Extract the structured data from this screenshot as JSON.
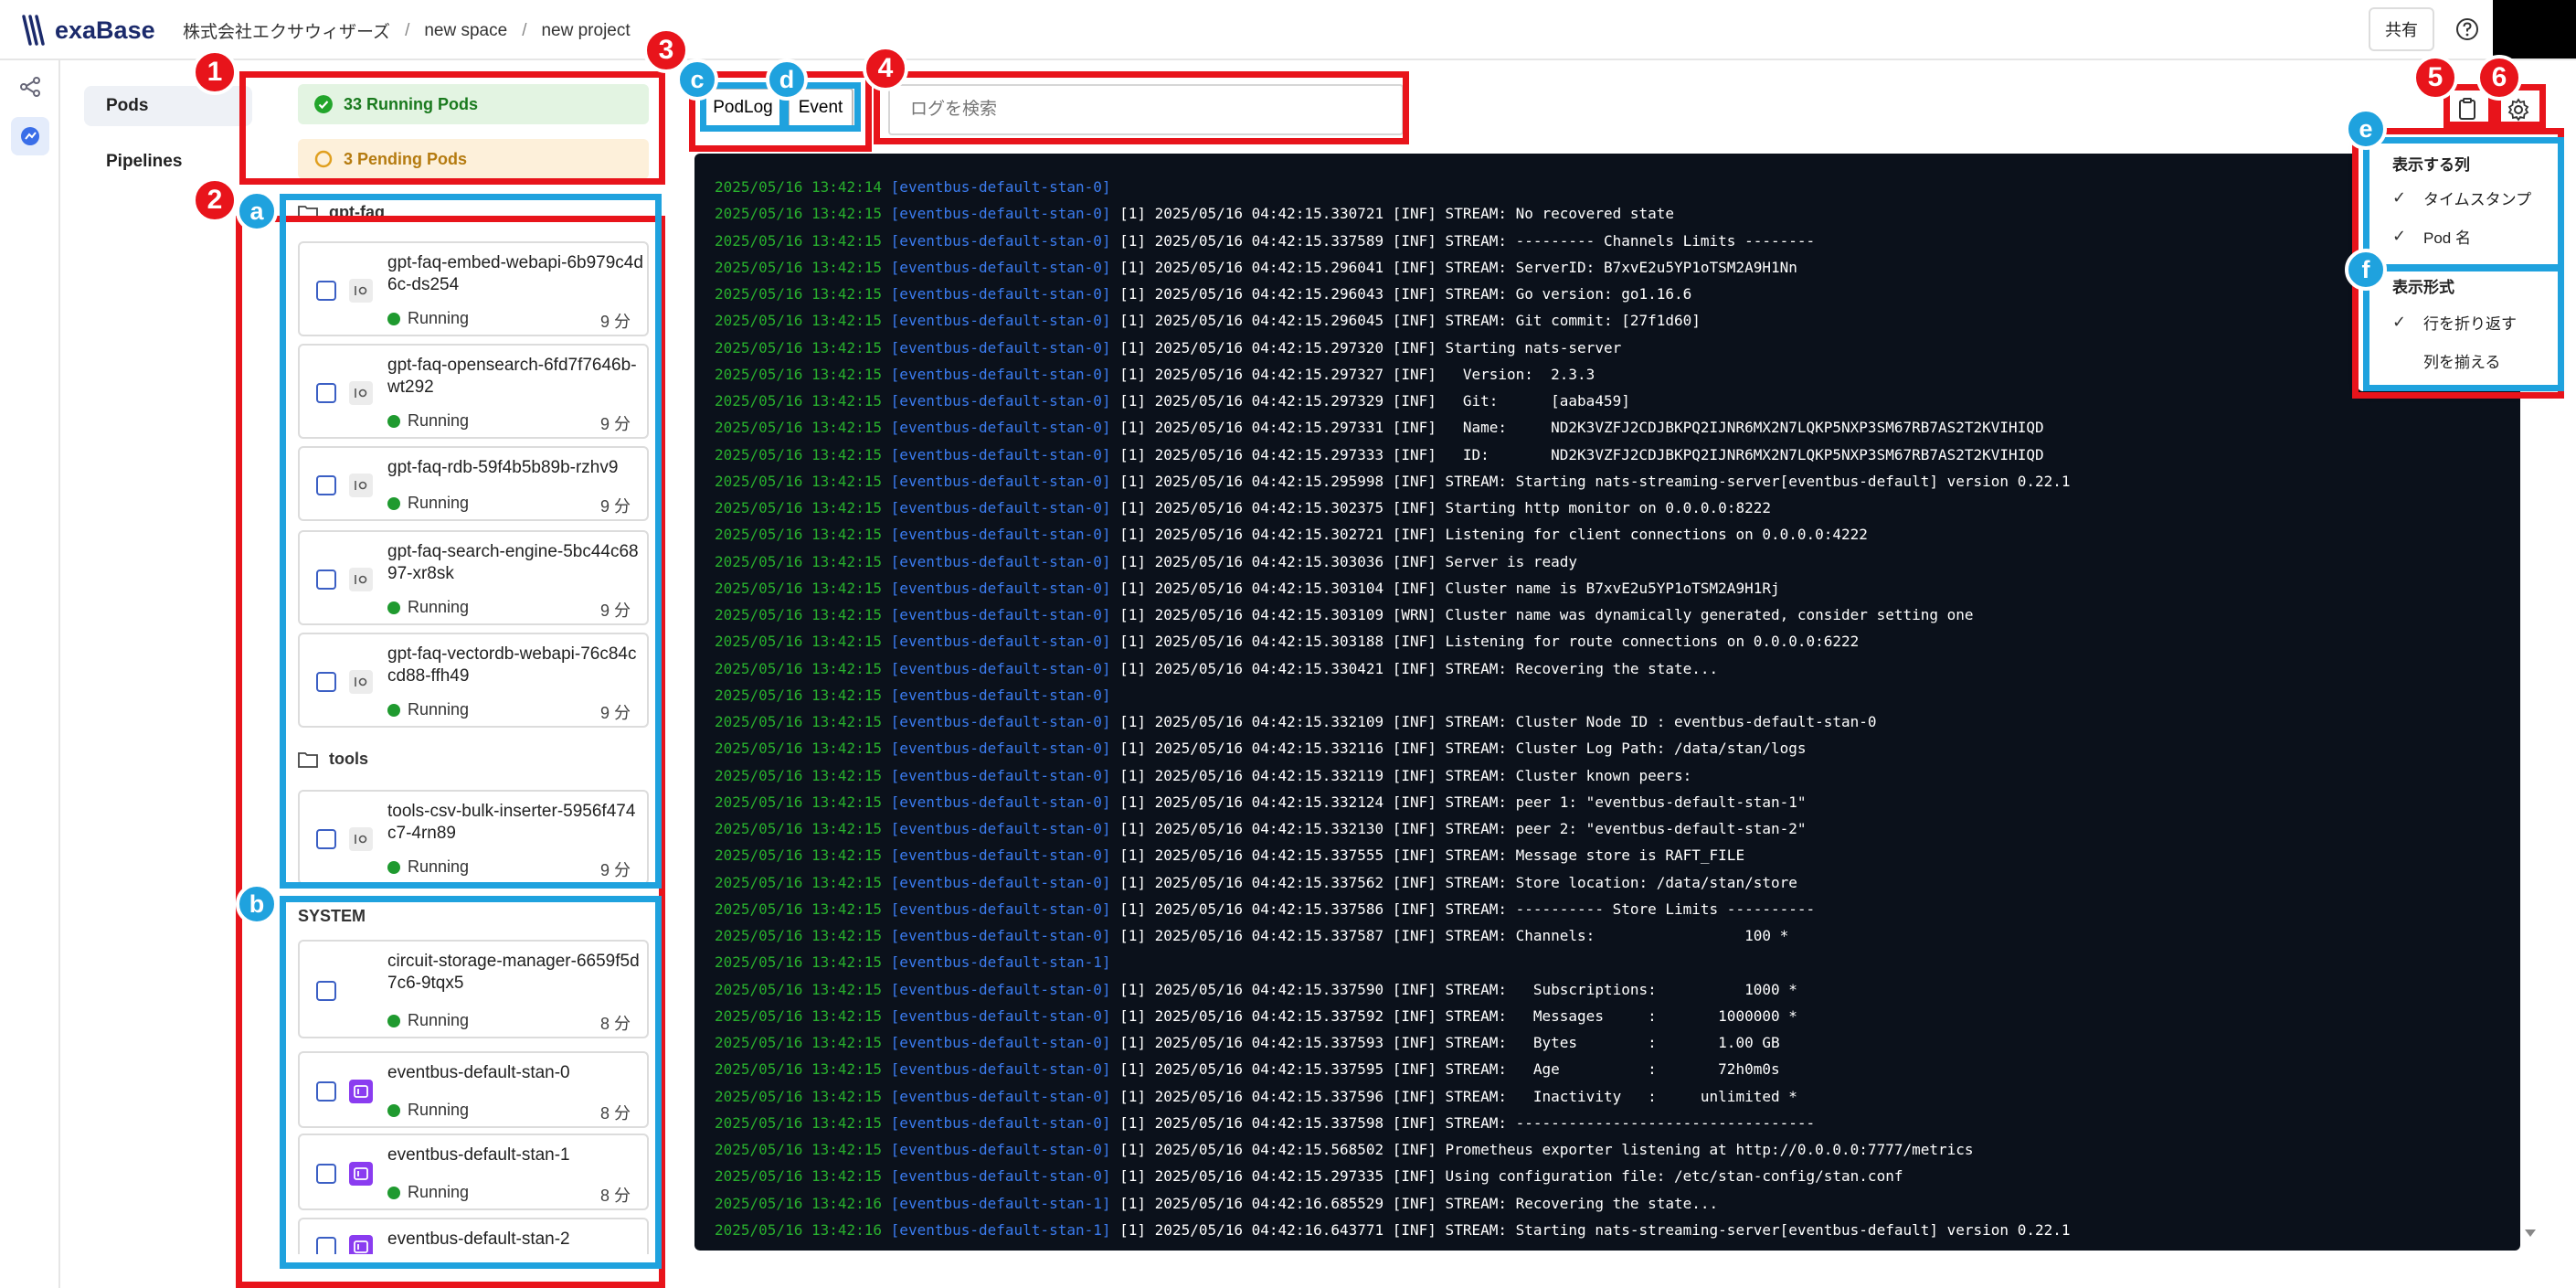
{
  "app": {
    "logo": "exaBase",
    "breadcrumb": [
      "株式会社エクサウィザーズ",
      "new space",
      "new project"
    ],
    "share_label": "共有"
  },
  "nav": {
    "pods": "Pods",
    "pipelines": "Pipelines"
  },
  "stats": {
    "running": "33 Running Pods",
    "pending": "3 Pending Pods"
  },
  "groups": {
    "gptfaq": "gpt-faq",
    "tools": "tools",
    "system": "SYSTEM"
  },
  "pods": [
    {
      "name": "gpt-faq-embed-webapi-6b979c4d6c-ds254",
      "status": "Running",
      "age": "9 分"
    },
    {
      "name": "gpt-faq-opensearch-6fd7f7646b-wt292",
      "status": "Running",
      "age": "9 分"
    },
    {
      "name": "gpt-faq-rdb-59f4b5b89b-rzhv9",
      "status": "Running",
      "age": "9 分"
    },
    {
      "name": "gpt-faq-search-engine-5bc44c6897-xr8sk",
      "status": "Running",
      "age": "9 分"
    },
    {
      "name": "gpt-faq-vectordb-webapi-76c84ccd88-ffh49",
      "status": "Running",
      "age": "9 分"
    },
    {
      "name": "tools-csv-bulk-inserter-5956f474c7-4rn89",
      "status": "Running",
      "age": "9 分"
    },
    {
      "name": "circuit-storage-manager-6659f5d7c6-9tqx5",
      "status": "Running",
      "age": "8 分"
    },
    {
      "name": "eventbus-default-stan-0",
      "status": "Running",
      "age": "8 分"
    },
    {
      "name": "eventbus-default-stan-1",
      "status": "Running",
      "age": "8 分"
    },
    {
      "name": "eventbus-default-stan-2",
      "status": "",
      "age": ""
    }
  ],
  "tabs": {
    "podlog": "PodLog",
    "event": "Event"
  },
  "search": {
    "placeholder": "ログを検索"
  },
  "menu": {
    "columns_h": "表示する列",
    "timestamp": "タイムスタンプ",
    "podname": "Pod 名",
    "format_h": "表示形式",
    "wrap": "行を折り返す",
    "align": "列を揃える"
  },
  "annotations": [
    "1",
    "2",
    "3",
    "4",
    "5",
    "6",
    "a",
    "b",
    "c",
    "d",
    "e",
    "f"
  ],
  "logs": [
    [
      "2025/05/16 13:42:14",
      "[eventbus-default-stan-0]",
      ""
    ],
    [
      "2025/05/16 13:42:15",
      "[eventbus-default-stan-0]",
      "[1] 2025/05/16 04:42:15.330721 [INF] STREAM: No recovered state"
    ],
    [
      "2025/05/16 13:42:15",
      "[eventbus-default-stan-0]",
      "[1] 2025/05/16 04:42:15.337589 [INF] STREAM: --------- Channels Limits --------"
    ],
    [
      "2025/05/16 13:42:15",
      "[eventbus-default-stan-0]",
      "[1] 2025/05/16 04:42:15.296041 [INF] STREAM: ServerID: B7xvE2u5YP1oTSM2A9H1Nn"
    ],
    [
      "2025/05/16 13:42:15",
      "[eventbus-default-stan-0]",
      "[1] 2025/05/16 04:42:15.296043 [INF] STREAM: Go version: go1.16.6"
    ],
    [
      "2025/05/16 13:42:15",
      "[eventbus-default-stan-0]",
      "[1] 2025/05/16 04:42:15.296045 [INF] STREAM: Git commit: [27f1d60]"
    ],
    [
      "2025/05/16 13:42:15",
      "[eventbus-default-stan-0]",
      "[1] 2025/05/16 04:42:15.297320 [INF] Starting nats-server"
    ],
    [
      "2025/05/16 13:42:15",
      "[eventbus-default-stan-0]",
      "[1] 2025/05/16 04:42:15.297327 [INF]   Version:  2.3.3"
    ],
    [
      "2025/05/16 13:42:15",
      "[eventbus-default-stan-0]",
      "[1] 2025/05/16 04:42:15.297329 [INF]   Git:      [aaba459]"
    ],
    [
      "2025/05/16 13:42:15",
      "[eventbus-default-stan-0]",
      "[1] 2025/05/16 04:42:15.297331 [INF]   Name:     ND2K3VZFJ2CDJBKPQ2IJNR6MX2N7LQKP5NXP3SM67RB7AS2T2KVIHIQD"
    ],
    [
      "2025/05/16 13:42:15",
      "[eventbus-default-stan-0]",
      "[1] 2025/05/16 04:42:15.297333 [INF]   ID:       ND2K3VZFJ2CDJBKPQ2IJNR6MX2N7LQKP5NXP3SM67RB7AS2T2KVIHIQD"
    ],
    [
      "2025/05/16 13:42:15",
      "[eventbus-default-stan-0]",
      "[1] 2025/05/16 04:42:15.295998 [INF] STREAM: Starting nats-streaming-server[eventbus-default] version 0.22.1"
    ],
    [
      "2025/05/16 13:42:15",
      "[eventbus-default-stan-0]",
      "[1] 2025/05/16 04:42:15.302375 [INF] Starting http monitor on 0.0.0.0:8222"
    ],
    [
      "2025/05/16 13:42:15",
      "[eventbus-default-stan-0]",
      "[1] 2025/05/16 04:42:15.302721 [INF] Listening for client connections on 0.0.0.0:4222"
    ],
    [
      "2025/05/16 13:42:15",
      "[eventbus-default-stan-0]",
      "[1] 2025/05/16 04:42:15.303036 [INF] Server is ready"
    ],
    [
      "2025/05/16 13:42:15",
      "[eventbus-default-stan-0]",
      "[1] 2025/05/16 04:42:15.303104 [INF] Cluster name is B7xvE2u5YP1oTSM2A9H1Rj"
    ],
    [
      "2025/05/16 13:42:15",
      "[eventbus-default-stan-0]",
      "[1] 2025/05/16 04:42:15.303109 [WRN] Cluster name was dynamically generated, consider setting one"
    ],
    [
      "2025/05/16 13:42:15",
      "[eventbus-default-stan-0]",
      "[1] 2025/05/16 04:42:15.303188 [INF] Listening for route connections on 0.0.0.0:6222"
    ],
    [
      "2025/05/16 13:42:15",
      "[eventbus-default-stan-0]",
      "[1] 2025/05/16 04:42:15.330421 [INF] STREAM: Recovering the state..."
    ],
    [
      "2025/05/16 13:42:15",
      "[eventbus-default-stan-0]",
      ""
    ],
    [
      "2025/05/16 13:42:15",
      "[eventbus-default-stan-0]",
      "[1] 2025/05/16 04:42:15.332109 [INF] STREAM: Cluster Node ID : eventbus-default-stan-0"
    ],
    [
      "2025/05/16 13:42:15",
      "[eventbus-default-stan-0]",
      "[1] 2025/05/16 04:42:15.332116 [INF] STREAM: Cluster Log Path: /data/stan/logs"
    ],
    [
      "2025/05/16 13:42:15",
      "[eventbus-default-stan-0]",
      "[1] 2025/05/16 04:42:15.332119 [INF] STREAM: Cluster known peers:"
    ],
    [
      "2025/05/16 13:42:15",
      "[eventbus-default-stan-0]",
      "[1] 2025/05/16 04:42:15.332124 [INF] STREAM: peer 1: \"eventbus-default-stan-1\""
    ],
    [
      "2025/05/16 13:42:15",
      "[eventbus-default-stan-0]",
      "[1] 2025/05/16 04:42:15.332130 [INF] STREAM: peer 2: \"eventbus-default-stan-2\""
    ],
    [
      "2025/05/16 13:42:15",
      "[eventbus-default-stan-0]",
      "[1] 2025/05/16 04:42:15.337555 [INF] STREAM: Message store is RAFT_FILE"
    ],
    [
      "2025/05/16 13:42:15",
      "[eventbus-default-stan-0]",
      "[1] 2025/05/16 04:42:15.337562 [INF] STREAM: Store location: /data/stan/store"
    ],
    [
      "2025/05/16 13:42:15",
      "[eventbus-default-stan-0]",
      "[1] 2025/05/16 04:42:15.337586 [INF] STREAM: ---------- Store Limits ----------"
    ],
    [
      "2025/05/16 13:42:15",
      "[eventbus-default-stan-0]",
      "[1] 2025/05/16 04:42:15.337587 [INF] STREAM: Channels:                 100 *"
    ],
    [
      "2025/05/16 13:42:15",
      "[eventbus-default-stan-1]",
      ""
    ],
    [
      "2025/05/16 13:42:15",
      "[eventbus-default-stan-0]",
      "[1] 2025/05/16 04:42:15.337590 [INF] STREAM:   Subscriptions:          1000 *"
    ],
    [
      "2025/05/16 13:42:15",
      "[eventbus-default-stan-0]",
      "[1] 2025/05/16 04:42:15.337592 [INF] STREAM:   Messages     :       1000000 *"
    ],
    [
      "2025/05/16 13:42:15",
      "[eventbus-default-stan-0]",
      "[1] 2025/05/16 04:42:15.337593 [INF] STREAM:   Bytes        :       1.00 GB"
    ],
    [
      "2025/05/16 13:42:15",
      "[eventbus-default-stan-0]",
      "[1] 2025/05/16 04:42:15.337595 [INF] STREAM:   Age          :       72h0m0s"
    ],
    [
      "2025/05/16 13:42:15",
      "[eventbus-default-stan-0]",
      "[1] 2025/05/16 04:42:15.337596 [INF] STREAM:   Inactivity   :     unlimited *"
    ],
    [
      "2025/05/16 13:42:15",
      "[eventbus-default-stan-0]",
      "[1] 2025/05/16 04:42:15.337598 [INF] STREAM: ----------------------------------"
    ],
    [
      "2025/05/16 13:42:15",
      "[eventbus-default-stan-0]",
      "[1] 2025/05/16 04:42:15.568502 [INF] Prometheus exporter listening at http://0.0.0.0:7777/metrics"
    ],
    [
      "2025/05/16 13:42:15",
      "[eventbus-default-stan-0]",
      "[1] 2025/05/16 04:42:15.297335 [INF] Using configuration file: /etc/stan-config/stan.conf"
    ],
    [
      "2025/05/16 13:42:16",
      "[eventbus-default-stan-1]",
      "[1] 2025/05/16 04:42:16.685529 [INF] STREAM: Recovering the state..."
    ],
    [
      "2025/05/16 13:42:16",
      "[eventbus-default-stan-1]",
      "[1] 2025/05/16 04:42:16.643771 [INF] STREAM: Starting nats-streaming-server[eventbus-default] version 0.22.1"
    ]
  ]
}
